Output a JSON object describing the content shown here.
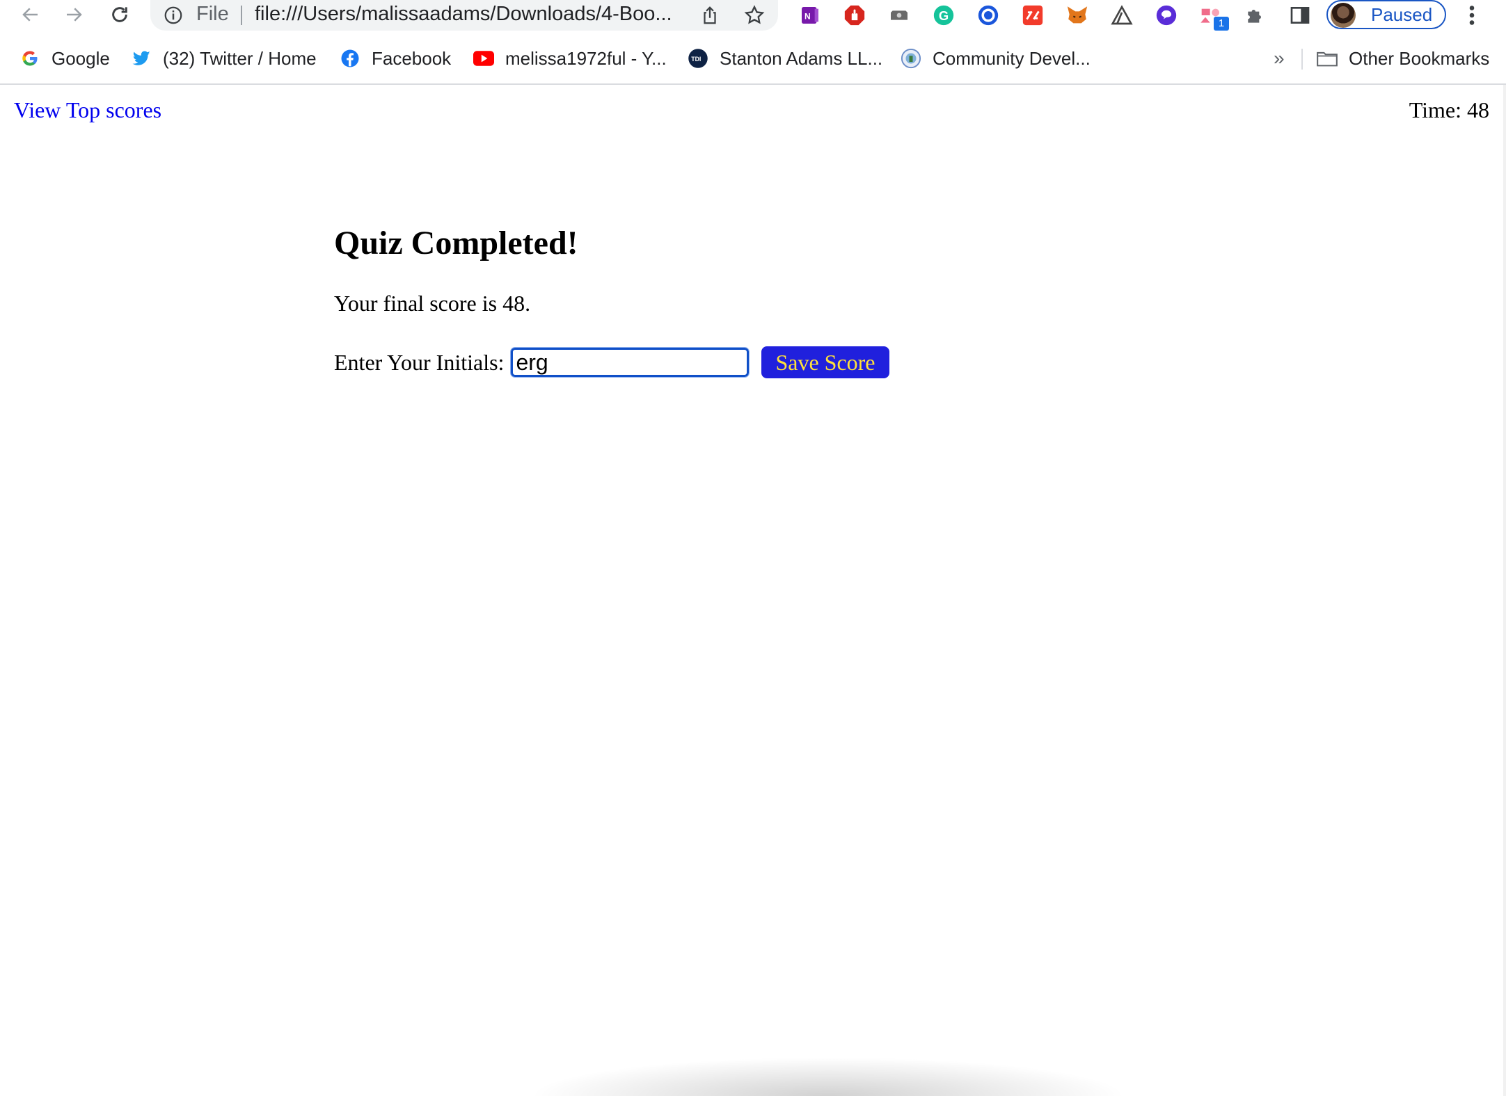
{
  "browser": {
    "omnibox": {
      "scheme_label": "File",
      "url": "file:///Users/malissaadams/Downloads/4-Boo..."
    },
    "extensions": [
      {
        "icon": "onenote-icon",
        "color": "#7719aa"
      },
      {
        "icon": "adblock-icon",
        "color": "#d7261e"
      },
      {
        "icon": "camera-icon",
        "color": "#6a6a6a"
      },
      {
        "icon": "grammarly-icon",
        "color": "#15c39a"
      },
      {
        "icon": "circle-target-icon",
        "color": "#1a56db"
      },
      {
        "icon": "pdf-sign-icon",
        "color": "#f23b2b"
      },
      {
        "icon": "metamask-icon",
        "color": "#e2761b"
      },
      {
        "icon": "mountain-icon",
        "color": "#444444"
      },
      {
        "icon": "chat-bubble-icon",
        "color": "#5a2dd8"
      },
      {
        "icon": "shapes-icon",
        "color": "#f06c8a",
        "badge": "1"
      },
      {
        "icon": "puzzle-icon",
        "color": "#5f6368"
      },
      {
        "icon": "sidepanel-icon",
        "color": "#5f6368"
      }
    ],
    "profile": {
      "label": "Paused"
    }
  },
  "bookmarks": {
    "items": [
      {
        "label": "Google",
        "icon": "google-icon"
      },
      {
        "label": "(32) Twitter / Home",
        "icon": "twitter-icon"
      },
      {
        "label": "Facebook",
        "icon": "facebook-icon"
      },
      {
        "label": "melissa1972ful - Y...",
        "icon": "youtube-icon"
      },
      {
        "label": "Stanton Adams LL...",
        "icon": "tdi-icon"
      },
      {
        "label": "Community Devel...",
        "icon": "seal-icon"
      }
    ],
    "overflow_label": "»",
    "other_label": "Other Bookmarks"
  },
  "page": {
    "top_link": "View Top scores",
    "timer": "Time: 48",
    "heading": "Quiz Completed!",
    "final_score": "Your final score is 48.",
    "initials_label": "Enter Your Initials:",
    "initials_value": "erg",
    "save_label": "Save Score",
    "colors": {
      "link": "#0000ee",
      "button_bg": "#2020dd",
      "button_text": "#ffe13a"
    }
  }
}
